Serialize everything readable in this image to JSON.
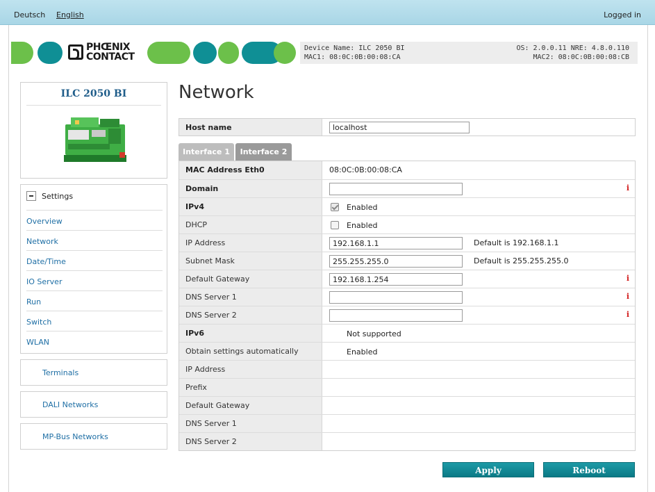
{
  "topbar": {
    "lang_de": "Deutsch",
    "lang_en": "English",
    "status": "Logged in"
  },
  "brand": {
    "logo_text_line1": "PHŒNIX",
    "logo_text_line2": "CONTACT",
    "green": "#6cc04a",
    "teal": "#0f8f95"
  },
  "device": {
    "name_line": "Device Name: ILC 2050 BI",
    "mac1_line": "MAC1: 08:0C:0B:00:08:CA",
    "os_line": "OS: 2.0.0.11 NRE: 4.8.0.110",
    "mac2_line": "MAC2: 08:0C:0B:00:08:CB"
  },
  "sidebar": {
    "device_name": "ILC 2050 BI",
    "settings_label": "Settings",
    "items": [
      {
        "label": "Overview"
      },
      {
        "label": "Network"
      },
      {
        "label": "Date/Time"
      },
      {
        "label": "IO Server"
      },
      {
        "label": "Run"
      },
      {
        "label": "Switch"
      },
      {
        "label": "WLAN"
      }
    ],
    "sections": [
      {
        "label": "Terminals"
      },
      {
        "label": "DALI Networks"
      },
      {
        "label": "MP-Bus Networks"
      }
    ]
  },
  "main": {
    "title": "Network",
    "host_label": "Host name",
    "host_value": "localhost",
    "tabs": [
      {
        "label": "Interface 1"
      },
      {
        "label": "Interface 2"
      }
    ],
    "rows": {
      "mac": {
        "label": "MAC Address Eth0",
        "value": "08:0C:0B:00:08:CA"
      },
      "domain": {
        "label": "Domain",
        "value": ""
      },
      "ipv4": {
        "label": "IPv4",
        "value": "Enabled"
      },
      "dhcp": {
        "label": "DHCP",
        "value": "Enabled"
      },
      "ip": {
        "label": "IP Address",
        "value": "192.168.1.1",
        "default": "Default is 192.168.1.1"
      },
      "subnet": {
        "label": "Subnet Mask",
        "value": "255.255.255.0",
        "default": "Default is 255.255.255.0"
      },
      "gateway": {
        "label": "Default Gateway",
        "value": "192.168.1.254"
      },
      "dns1": {
        "label": "DNS Server 1",
        "value": ""
      },
      "dns2": {
        "label": "DNS Server 2",
        "value": ""
      },
      "ipv6": {
        "label": "IPv6",
        "value": "Not supported"
      },
      "auto": {
        "label": "Obtain settings automatically",
        "value": "Enabled"
      },
      "ip6": {
        "label": "IP Address"
      },
      "prefix": {
        "label": "Prefix"
      },
      "gw6": {
        "label": "Default Gateway"
      },
      "dns61": {
        "label": "DNS Server 1"
      },
      "dns62": {
        "label": "DNS Server 2"
      }
    },
    "info_glyph": "i",
    "apply_label": "Apply",
    "reboot_label": "Reboot"
  }
}
